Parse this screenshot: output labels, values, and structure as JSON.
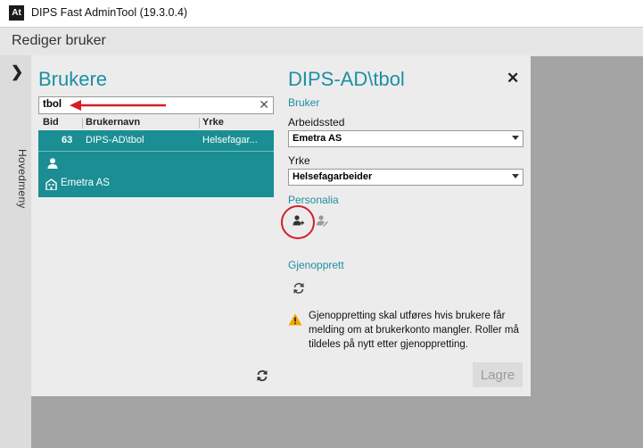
{
  "window": {
    "title": "DIPS Fast AdminTool (19.3.0.4)",
    "logo_text": "At"
  },
  "header": {
    "title": "Rediger bruker"
  },
  "sidebar": {
    "expand_icon": "chevron-right-icon",
    "nav_label": "Hovedmeny"
  },
  "users_pane": {
    "title": "Brukere",
    "search": {
      "value": "tbol",
      "clear_icon": "close-icon"
    },
    "columns": [
      "Bid",
      "Brukernavn",
      "Yrke"
    ],
    "rows": [
      {
        "bid": "63",
        "username": "DIPS-AD\\tbol",
        "occupation": "Helsefagar...",
        "organization": "Emetra AS"
      }
    ],
    "refresh_icon": "refresh-icon"
  },
  "detail_pane": {
    "title": "DIPS-AD\\tbol",
    "close_icon": "close-icon",
    "bruker_section": "Bruker",
    "workplace_label": "Arbeidssted",
    "workplace_value": "Emetra AS",
    "occupation_label": "Yrke",
    "occupation_value": "Helsefagarbeider",
    "personalia_section": "Personalia",
    "gjenopprett_section": "Gjenopprett",
    "warning_text": "Gjenoppretting skal utføres hvis brukere får melding om at brukerkonto mangler. Roller må tildeles på nytt etter gjenoppretting.",
    "save_label": "Lagre"
  },
  "colors": {
    "accent": "#1e8fa3",
    "selected_row": "#1a8e93",
    "annotation": "#d41f26"
  }
}
